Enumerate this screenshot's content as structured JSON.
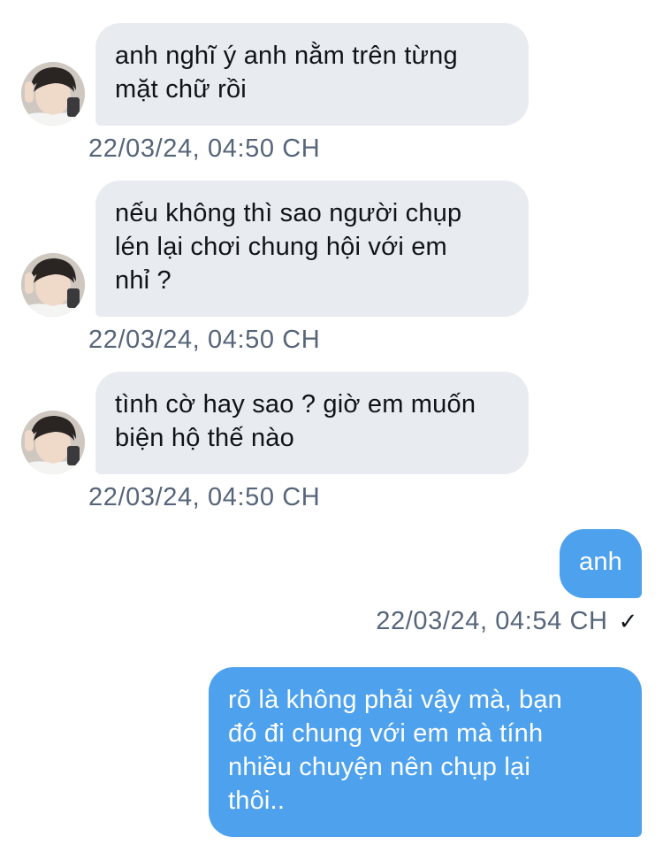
{
  "conversation": {
    "messages": [
      {
        "direction": "incoming",
        "text": "anh nghĩ ý anh nằm trên từng\nmặt chữ rồi",
        "timestamp": "22/03/24, 04:50 CH"
      },
      {
        "direction": "incoming",
        "text": "nếu không thì sao người chụp\nlén lại chơi chung hội với em\nnhỉ ?",
        "timestamp": "22/03/24, 04:50 CH"
      },
      {
        "direction": "incoming",
        "text": "tình cờ hay sao ? giờ em muốn\nbiện hộ thế nào",
        "timestamp": "22/03/24, 04:50 CH"
      },
      {
        "direction": "outgoing",
        "text": "anh",
        "timestamp": "22/03/24, 04:54 CH",
        "status_icon": "checkmark-icon",
        "status_glyph": "✓"
      },
      {
        "direction": "outgoing",
        "text": "rõ là không phải vậy mà, bạn\nđó đi chung với em mà tính\nnhiều chuyện nên chụp lại\nthôi.."
      }
    ]
  },
  "colors": {
    "incoming_bubble": "#e8ecf0",
    "outgoing_bubble": "#4da1ed",
    "timestamp_text": "#56657a"
  }
}
